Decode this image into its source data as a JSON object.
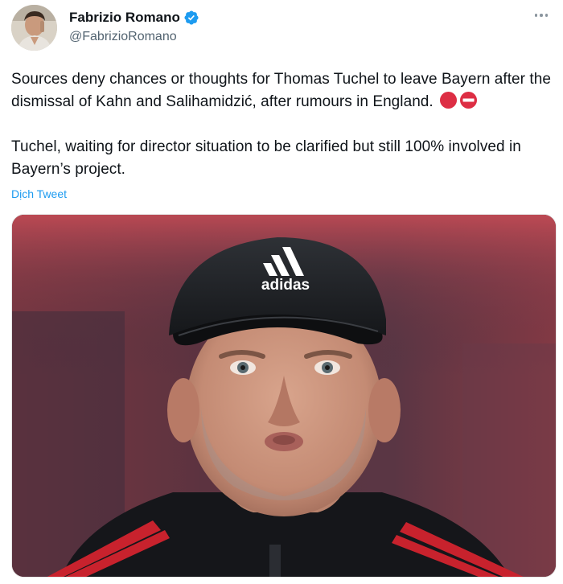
{
  "author": {
    "display_name": "Fabrizio Romano",
    "handle": "@FabrizioRomano",
    "verified": true
  },
  "icons": {
    "verified": "verified-badge-icon",
    "more": "more-options-icon",
    "emoji_1": "red-circle-emoji",
    "emoji_2": "no-entry-emoji"
  },
  "tweet": {
    "paragraph_1": "Sources deny chances or thoughts for Thomas Tuchel to leave Bayern after the dismissal of Kahn and Salihamidzić, after rumours in England.",
    "paragraph_2": "Tuchel, waiting for director situation to be clarified but still 100% involved in Bayern’s project.",
    "translate_label": "Dịch Tweet"
  },
  "media": {
    "cap_logo_text": "adidas"
  },
  "colors": {
    "accent": "#1d9bf0",
    "text": "#0f1419",
    "muted": "#536471"
  }
}
